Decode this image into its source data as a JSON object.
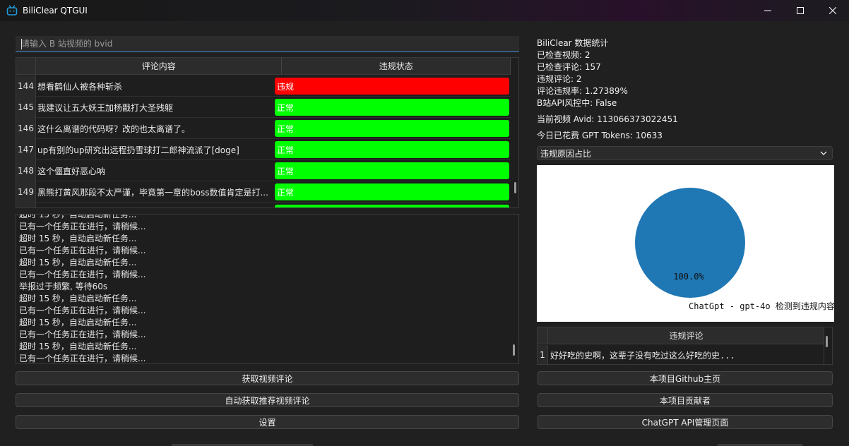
{
  "window": {
    "title": "BiliClear QTGUI",
    "minimize_glyph": "—",
    "maximize_glyph": "☐",
    "close_glyph": "✕"
  },
  "input": {
    "placeholder": "请输入 B 站视频的 bvid",
    "value": ""
  },
  "comments_table": {
    "headers": [
      "评论内容",
      "违规状态"
    ],
    "rows": [
      {
        "num": "144",
        "content": "想看鹤仙人被各种斩杀",
        "status": "违规",
        "violation": true
      },
      {
        "num": "145",
        "content": "我建议让五大妖王加杨戬打大圣残躯",
        "status": "正常",
        "violation": false
      },
      {
        "num": "146",
        "content": "这什么离谱的代码呀？改的也太离谱了。",
        "status": "正常",
        "violation": false
      },
      {
        "num": "147",
        "content": "up有别的up研究出远程扔雪球打二郎神流派了[doge]",
        "status": "正常",
        "violation": false
      },
      {
        "num": "148",
        "content": "这个僵直好恶心呐",
        "status": "正常",
        "violation": false
      },
      {
        "num": "149",
        "content": "黑熊打黄风那段不太严谨，毕竟第一章的boss数值肯定是打...",
        "status": "正常",
        "violation": false
      }
    ],
    "status_colors": {
      "violation": "#ff0000",
      "normal": "#00ff00"
    }
  },
  "log": {
    "lines": [
      "超时 15 秒，自动启动新任务...",
      "已有一个任务正在进行，请稍候...",
      "超时 15 秒，自动启动新任务...",
      "已有一个任务正在进行，请稍候...",
      "超时 15 秒，自动启动新任务...",
      "已有一个任务正在进行，请稍候...",
      "举报过于频繁, 等待60s",
      "超时 15 秒，自动启动新任务...",
      "已有一个任务正在进行，请稍候...",
      "超时 15 秒，自动启动新任务...",
      "已有一个任务正在进行，请稍候...",
      "超时 15 秒，自动启动新任务...",
      "已有一个任务正在进行，请稍候..."
    ]
  },
  "left_buttons": {
    "fetch": "获取视频评论",
    "auto_fetch": "自动获取推荐视频评论",
    "settings": "设置"
  },
  "stats": {
    "title": "BiliClear 数据统计",
    "checked_videos": "已检查视频: 2",
    "checked_comments": "已检查评论: 157",
    "violation_comments": "违规评论: 2",
    "violation_rate": "评论违规率: 1.27389%",
    "api_risk": "B站API风控中: False",
    "current_video": "当前视频 Avid: 113066373022451",
    "gpt_tokens": "今日已花费 GPT Tokens: 10633"
  },
  "chart_selector": {
    "selected": "违规原因占比"
  },
  "chart_data": {
    "type": "pie",
    "labels": [
      "ChatGpt - gpt-4o 检测到违规内容"
    ],
    "values": [
      100.0
    ],
    "percent_labels": [
      "100.0%"
    ],
    "colors": [
      "#1f77b4"
    ]
  },
  "violation_table": {
    "header": "违规评论",
    "rows": [
      {
        "num": "1",
        "content": "好好吃的史啊，这辈子没有吃过这么好吃的史..."
      }
    ]
  },
  "right_buttons": {
    "github": "本项目Github主页",
    "contributors": "本项目贡献者",
    "chatgpt_api": "ChatGPT API管理页面"
  }
}
